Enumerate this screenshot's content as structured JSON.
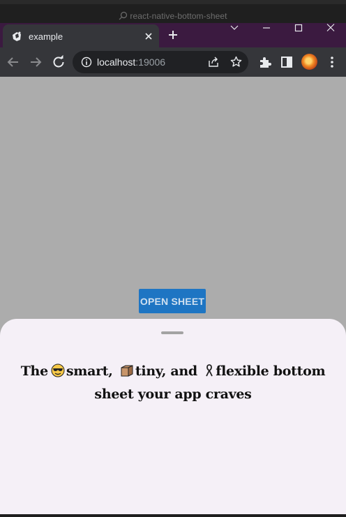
{
  "window": {
    "title": "react-native-bottom-sheet"
  },
  "tab": {
    "title": "example"
  },
  "address_bar": {
    "host": "localhost",
    "port": ":19006"
  },
  "page": {
    "open_button_label": "OPEN SHEET",
    "sheet": {
      "headline_part1": "The",
      "headline_part2": "smart,",
      "headline_part3": "tiny, and",
      "headline_part4": "flexible bottom",
      "headline_part5": "sheet your app craves"
    }
  },
  "icons": [
    "search-icon",
    "favicon-icon",
    "close-icon",
    "plus-icon",
    "chevron-down-icon",
    "minimize-icon",
    "maximize-icon",
    "close-window-icon",
    "back-icon",
    "forward-icon",
    "reload-icon",
    "info-icon",
    "share-icon",
    "star-icon",
    "puzzle-icon",
    "side-panel-icon",
    "kebab-menu-icon",
    "sunglasses-emoji-icon",
    "box-emoji-icon",
    "ribbon-emoji-icon"
  ],
  "colors": {
    "tab_strip": "#3b1a40",
    "toolbar": "#35363a",
    "page_background": "#acacac",
    "button": "#1e75c3",
    "sheet": "#f5f0f7"
  }
}
